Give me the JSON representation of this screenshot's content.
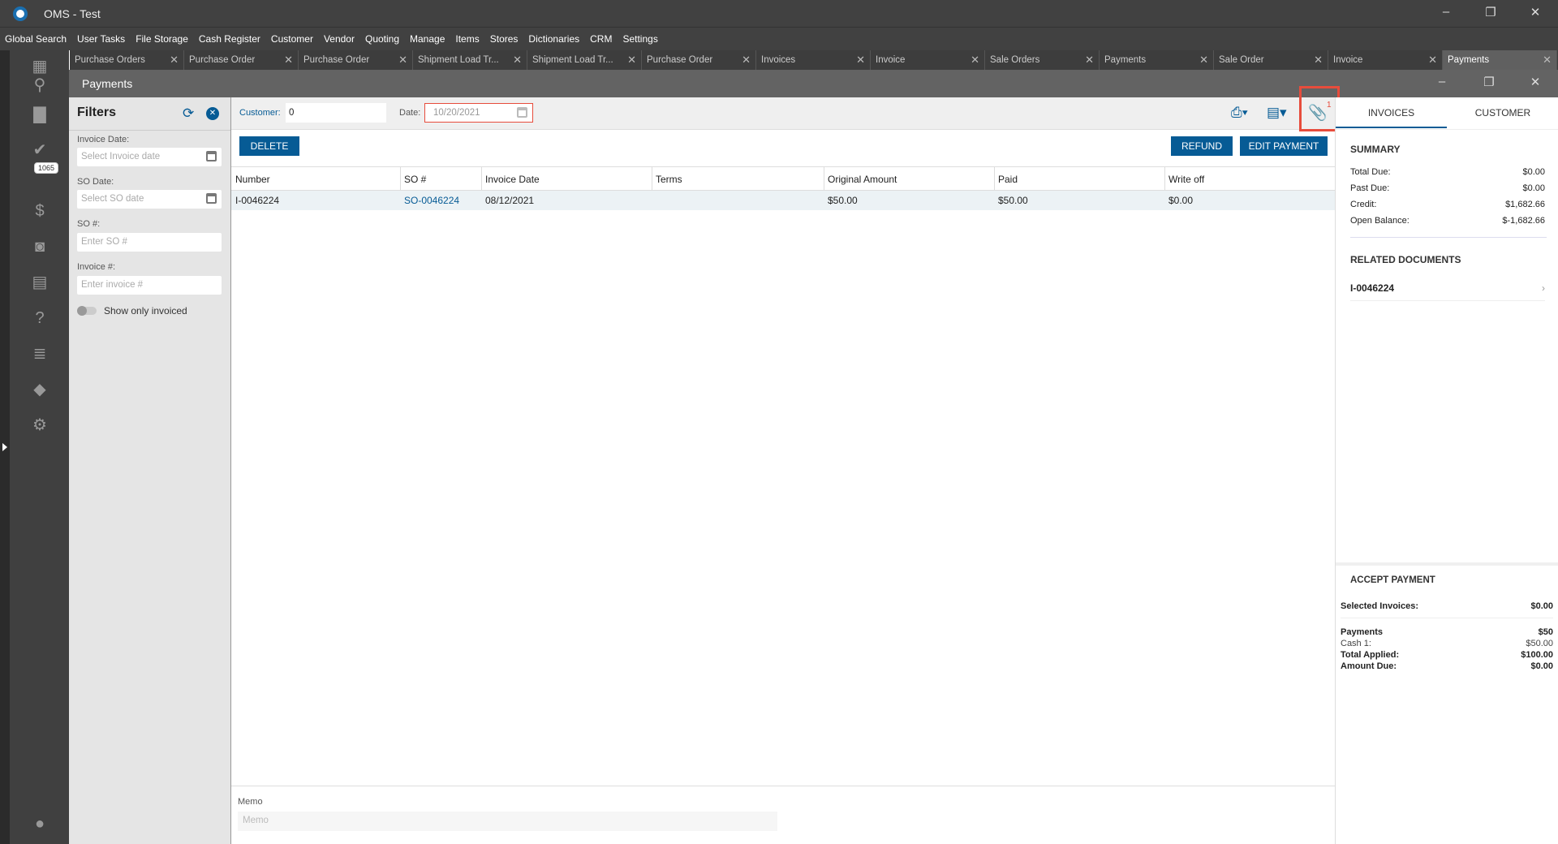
{
  "app": {
    "title": "OMS - Test"
  },
  "menu": [
    "Global Search",
    "User Tasks",
    "File Storage",
    "Cash Register",
    "Customer",
    "Vendor",
    "Quoting",
    "Manage",
    "Items",
    "Stores",
    "Dictionaries",
    "CRM",
    "Settings"
  ],
  "tabs": [
    "Purchase Orders",
    "Purchase Order",
    "Purchase Order",
    "Shipment Load Tr...",
    "Shipment Load Tr...",
    "Purchase Order",
    "Invoices",
    "Invoice",
    "Sale Orders",
    "Payments",
    "Sale Order",
    "Invoice",
    "Payments"
  ],
  "sidebar": {
    "badge": "1065"
  },
  "window": {
    "title": "Payments"
  },
  "filters": {
    "title": "Filters",
    "invoice_date_label": "Invoice Date:",
    "invoice_date_placeholder": "Select Invoice date",
    "so_date_label": "SO Date:",
    "so_date_placeholder": "Select SO date",
    "so_label": "SO #:",
    "so_placeholder": "Enter SO #",
    "invoice_label": "Invoice #:",
    "invoice_placeholder": "Enter invoice #",
    "toggle_label": "Show only invoiced"
  },
  "toolbar": {
    "customer_label": "Customer:",
    "customer_value": "0",
    "date_label": "Date:",
    "date_value": "10/20/2021",
    "attachment_count": "1"
  },
  "buttons": {
    "delete": "DELETE",
    "refund": "REFUND",
    "edit_payment": "EDIT PAYMENT"
  },
  "table": {
    "columns": [
      "Number",
      "SO #",
      "Invoice Date",
      "Terms",
      "Original Amount",
      "Paid",
      "Write off"
    ],
    "rows": [
      {
        "number": "I-0046224",
        "so": "SO-0046224",
        "invoice_date": "08/12/2021",
        "terms": "",
        "original": "$50.00",
        "paid": "$50.00",
        "writeoff": "$0.00"
      }
    ]
  },
  "memo": {
    "label": "Memo",
    "placeholder": "Memo"
  },
  "right": {
    "tabs": [
      "INVOICES",
      "CUSTOMER"
    ],
    "summary_title": "SUMMARY",
    "summary": [
      {
        "label": "Total Due:",
        "value": "$0.00"
      },
      {
        "label": "Past Due:",
        "value": "$0.00"
      },
      {
        "label": "Credit:",
        "value": "$1,682.66"
      },
      {
        "label": "Open Balance:",
        "value": "$-1,682.66"
      }
    ],
    "related_title": "RELATED DOCUMENTS",
    "related": [
      "I-0046224"
    ],
    "accept_title": "ACCEPT PAYMENT",
    "selected_label": "Selected Invoices:",
    "selected_value": "$0.00",
    "payments_label": "Payments",
    "payments_value": "$50",
    "cash_label": "Cash 1:",
    "cash_value": "$50.00",
    "applied_label": "Total Applied:",
    "applied_value": "$100.00",
    "due_label": "Amount Due:",
    "due_value": "$0.00"
  },
  "colors": {
    "accent": "#065b95",
    "highlight": "#e74c3c"
  }
}
